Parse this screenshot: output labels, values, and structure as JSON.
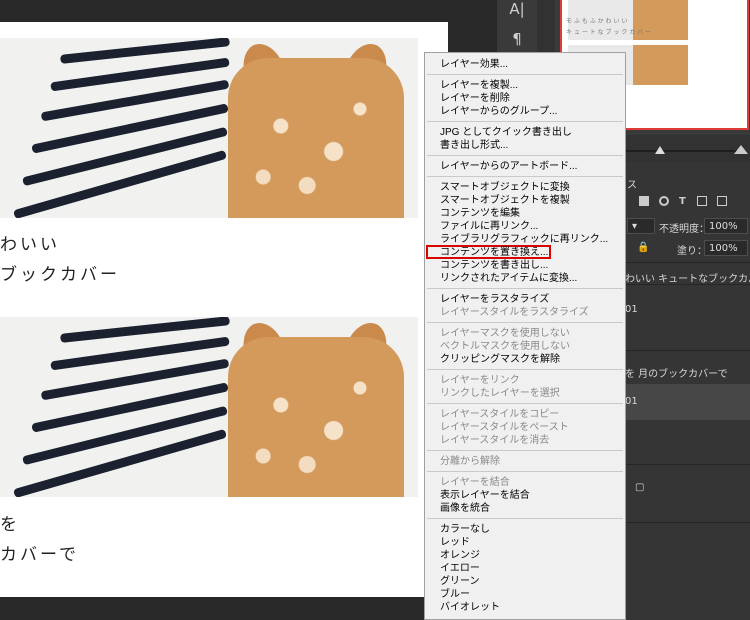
{
  "canvas": {
    "captions": [
      "わいい",
      "ブックカバー",
      "を",
      "カバーで"
    ]
  },
  "toolbar": {
    "icons": [
      "type-icon",
      "paragraph-icon"
    ],
    "type_glyph": "A|",
    "paragraph_glyph": "¶"
  },
  "navigator": {
    "thumb_text_1": "モ ふ も ふ か わ い い",
    "thumb_text_2": "キ ュ ー ト な ブ ッ ク カ バ ー"
  },
  "layers_panel": {
    "tab_partial": "ス",
    "opacity_label": "不透明度：",
    "opacity_value": "100%",
    "fill_label": "塗り：",
    "fill_value": "100%",
    "layer_names": [
      "わいい キュートなブックカバー",
      "01",
      "を 月のブックカバーで",
      "01"
    ]
  },
  "context_menu": {
    "groups": [
      [
        {
          "label": "レイヤー効果...",
          "enabled": true
        }
      ],
      [
        {
          "label": "レイヤーを複製...",
          "enabled": true
        },
        {
          "label": "レイヤーを削除",
          "enabled": true
        },
        {
          "label": "レイヤーからのグループ...",
          "enabled": true
        }
      ],
      [
        {
          "label": "JPG としてクイック書き出し",
          "enabled": true
        },
        {
          "label": "書き出し形式...",
          "enabled": true
        }
      ],
      [
        {
          "label": "レイヤーからのアートボード...",
          "enabled": true
        }
      ],
      [
        {
          "label": "スマートオブジェクトに変換",
          "enabled": true
        },
        {
          "label": "スマートオブジェクトを複製",
          "enabled": true
        },
        {
          "label": "コンテンツを編集",
          "enabled": true
        },
        {
          "label": "ファイルに再リンク...",
          "enabled": true
        },
        {
          "label": "ライブラリグラフィックに再リンク...",
          "enabled": true
        },
        {
          "label": "コンテンツを置き換え...",
          "enabled": true
        },
        {
          "label": "コンテンツを書き出し...",
          "enabled": true
        },
        {
          "label": "リンクされたアイテムに変換...",
          "enabled": true
        }
      ],
      [
        {
          "label": "レイヤーをラスタライズ",
          "enabled": true
        },
        {
          "label": "レイヤースタイルをラスタライズ",
          "enabled": false
        }
      ],
      [
        {
          "label": "レイヤーマスクを使用しない",
          "enabled": false
        },
        {
          "label": "ベクトルマスクを使用しない",
          "enabled": false
        },
        {
          "label": "クリッピングマスクを解除",
          "enabled": true
        }
      ],
      [
        {
          "label": "レイヤーをリンク",
          "enabled": false
        },
        {
          "label": "リンクしたレイヤーを選択",
          "enabled": false
        }
      ],
      [
        {
          "label": "レイヤースタイルをコピー",
          "enabled": false
        },
        {
          "label": "レイヤースタイルをペースト",
          "enabled": false
        },
        {
          "label": "レイヤースタイルを消去",
          "enabled": false
        }
      ],
      [
        {
          "label": "分離から解除",
          "enabled": false
        }
      ],
      [
        {
          "label": "レイヤーを結合",
          "enabled": false
        },
        {
          "label": "表示レイヤーを結合",
          "enabled": true
        },
        {
          "label": "画像を統合",
          "enabled": true
        }
      ],
      [
        {
          "label": "カラーなし",
          "enabled": true
        },
        {
          "label": "レッド",
          "enabled": true
        },
        {
          "label": "オレンジ",
          "enabled": true
        },
        {
          "label": "イエロー",
          "enabled": true
        },
        {
          "label": "グリーン",
          "enabled": true
        },
        {
          "label": "ブルー",
          "enabled": true
        },
        {
          "label": "バイオレット",
          "enabled": true
        }
      ]
    ],
    "highlighted_item": "コンテンツを置き換え...",
    "highlight_color": "#d90000"
  }
}
